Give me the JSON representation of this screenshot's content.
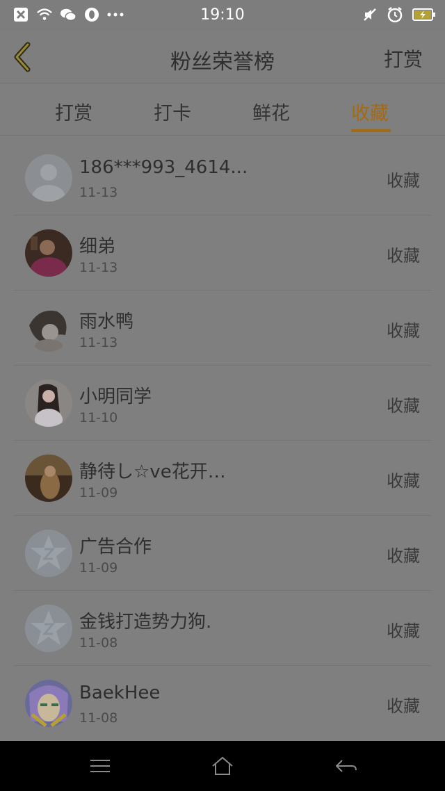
{
  "status": {
    "time": "19:10"
  },
  "header": {
    "title": "粉丝荣誉榜",
    "action": "打赏"
  },
  "tabs": [
    {
      "label": "打赏"
    },
    {
      "label": "打卡"
    },
    {
      "label": "鲜花"
    },
    {
      "label": "收藏",
      "active": true
    }
  ],
  "fans": [
    {
      "name": "186***993_4614...",
      "date": "11-13",
      "action": "收藏"
    },
    {
      "name": "细弟",
      "date": "11-13",
      "action": "收藏"
    },
    {
      "name": "雨水鸭",
      "date": "11-13",
      "action": "收藏"
    },
    {
      "name": "小明同学",
      "date": "11-10",
      "action": "收藏"
    },
    {
      "name": "静待し☆ve花开…",
      "date": "11-09",
      "action": "收藏"
    },
    {
      "name": "广告合作",
      "date": "11-09",
      "action": "收藏"
    },
    {
      "name": "金钱打造势力狗.",
      "date": "11-08",
      "action": "收藏"
    },
    {
      "name": "BaekHee",
      "date": "11-08",
      "action": "收藏"
    }
  ],
  "colors": {
    "accent": "#a46a10",
    "overlay": "#7f7f7f"
  }
}
